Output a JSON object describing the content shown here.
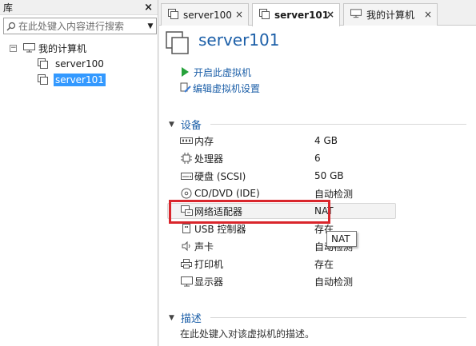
{
  "library": {
    "title": "库",
    "close": "×",
    "search_placeholder": "在此处键入内容进行搜索",
    "tree": {
      "root": {
        "expander": "−",
        "label": "我的计算机"
      },
      "items": [
        {
          "label": "server100",
          "selected": false
        },
        {
          "label": "server101",
          "selected": true
        }
      ]
    }
  },
  "tabs": [
    {
      "label": "server100",
      "close": "×",
      "active": false
    },
    {
      "label": "server101",
      "close": "×",
      "active": true
    },
    {
      "label": "我的计算机",
      "close": "×",
      "active": false
    }
  ],
  "vm": {
    "title": "server101",
    "actions": {
      "power_on": "开启此虚拟机",
      "edit_settings": "编辑虚拟机设置"
    }
  },
  "devices_section": {
    "title": "设备",
    "rows": [
      {
        "icon": "memory-icon",
        "name": "内存",
        "value": "4 GB"
      },
      {
        "icon": "processor-icon",
        "name": "处理器",
        "value": "6"
      },
      {
        "icon": "hard-disk-icon",
        "name": "硬盘 (SCSI)",
        "value": "50 GB"
      },
      {
        "icon": "cd-dvd-icon",
        "name": "CD/DVD (IDE)",
        "value": "自动检测"
      },
      {
        "icon": "network-adapter-icon",
        "name": "网络适配器",
        "value": "NAT"
      },
      {
        "icon": "usb-icon",
        "name": "USB 控制器",
        "value": "存在"
      },
      {
        "icon": "sound-icon",
        "name": "声卡",
        "value": "自动检测"
      },
      {
        "icon": "printer-icon",
        "name": "打印机",
        "value": "存在"
      },
      {
        "icon": "display-icon",
        "name": "显示器",
        "value": "自动检测"
      }
    ]
  },
  "tooltip": {
    "text": "NAT"
  },
  "description_section": {
    "title": "描述",
    "text": "在此处键入对该虚拟机的描述。"
  },
  "colors": {
    "link": "#1c5fa8",
    "selection": "#3399ff",
    "highlight_border": "#d9262c",
    "play": "#27a23b"
  }
}
